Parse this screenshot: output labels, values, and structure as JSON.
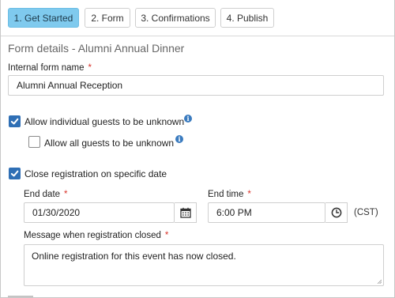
{
  "tabs": [
    {
      "label": "1. Get Started",
      "active": true
    },
    {
      "label": "2. Form",
      "active": false
    },
    {
      "label": "3. Confirmations",
      "active": false
    },
    {
      "label": "4. Publish",
      "active": false
    }
  ],
  "section": {
    "title": "Form details - Alumni Annual Dinner"
  },
  "internal_name": {
    "label": "Internal form name",
    "required_mark": "*",
    "value": "Alumni Annual Reception"
  },
  "allow_individual": {
    "label": "Allow individual guests to be unknown",
    "checked": true,
    "info_icon": "info-icon"
  },
  "allow_all": {
    "label": "Allow all guests to be unknown",
    "checked": false,
    "info_icon": "info-icon"
  },
  "close_registration": {
    "label": "Close registration on specific date",
    "checked": true
  },
  "end_date": {
    "label": "End date",
    "required_mark": "*",
    "value": "01/30/2020",
    "icon": "calendar-icon"
  },
  "end_time": {
    "label": "End time",
    "required_mark": "*",
    "value": "6:00 PM",
    "icon": "clock-icon",
    "timezone": "(CST)"
  },
  "message": {
    "label": "Message when registration closed",
    "required_mark": "*",
    "value": "Online registration for this event has now closed."
  },
  "colors": {
    "accent": "#7fcaee",
    "check": "#2f6fb5",
    "required": "#d9342b",
    "info": "#3a7bbf"
  }
}
